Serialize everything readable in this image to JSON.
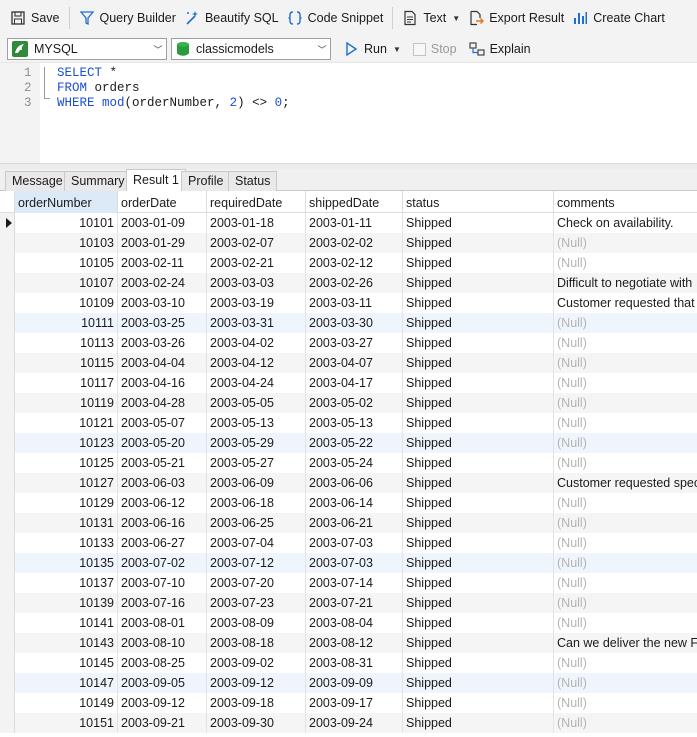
{
  "toolbar": {
    "save": "Save",
    "query_builder": "Query Builder",
    "beautify_sql": "Beautify SQL",
    "code_snippet": "Code Snippet",
    "text": "Text",
    "export_result": "Export Result",
    "create_chart": "Create Chart"
  },
  "connection": {
    "type": "MYSQL",
    "database": "classicmodels"
  },
  "actions": {
    "run": "Run",
    "stop": "Stop",
    "explain": "Explain"
  },
  "editor": {
    "line_numbers": [
      "1",
      "2",
      "3"
    ],
    "line1": {
      "kw": "SELECT",
      "rest": " *"
    },
    "line2": {
      "kw": "FROM",
      "rest": " orders"
    },
    "line3": {
      "kw": "WHERE",
      "fn": "mod",
      "p1": "(orderNumber, ",
      "n1": "2",
      "p2": ") <> ",
      "n2": "0",
      "p3": ";"
    }
  },
  "tabs": [
    "Message",
    "Summary",
    "Result 1",
    "Profile",
    "Status"
  ],
  "active_tab": "Result 1",
  "columns": [
    "orderNumber",
    "orderDate",
    "requiredDate",
    "shippedDate",
    "status",
    "comments"
  ],
  "rows": [
    [
      "10101",
      "2003-01-09",
      "2003-01-18",
      "2003-01-11",
      "Shipped",
      "Check on availability."
    ],
    [
      "10103",
      "2003-01-29",
      "2003-02-07",
      "2003-02-02",
      "Shipped",
      "(Null)"
    ],
    [
      "10105",
      "2003-02-11",
      "2003-02-21",
      "2003-02-12",
      "Shipped",
      "(Null)"
    ],
    [
      "10107",
      "2003-02-24",
      "2003-03-03",
      "2003-02-26",
      "Shipped",
      "Difficult to negotiate with"
    ],
    [
      "10109",
      "2003-03-10",
      "2003-03-19",
      "2003-03-11",
      "Shipped",
      "Customer requested that F"
    ],
    [
      "10111",
      "2003-03-25",
      "2003-03-31",
      "2003-03-30",
      "Shipped",
      "(Null)"
    ],
    [
      "10113",
      "2003-03-26",
      "2003-04-02",
      "2003-03-27",
      "Shipped",
      "(Null)"
    ],
    [
      "10115",
      "2003-04-04",
      "2003-04-12",
      "2003-04-07",
      "Shipped",
      "(Null)"
    ],
    [
      "10117",
      "2003-04-16",
      "2003-04-24",
      "2003-04-17",
      "Shipped",
      "(Null)"
    ],
    [
      "10119",
      "2003-04-28",
      "2003-05-05",
      "2003-05-02",
      "Shipped",
      "(Null)"
    ],
    [
      "10121",
      "2003-05-07",
      "2003-05-13",
      "2003-05-13",
      "Shipped",
      "(Null)"
    ],
    [
      "10123",
      "2003-05-20",
      "2003-05-29",
      "2003-05-22",
      "Shipped",
      "(Null)"
    ],
    [
      "10125",
      "2003-05-21",
      "2003-05-27",
      "2003-05-24",
      "Shipped",
      "(Null)"
    ],
    [
      "10127",
      "2003-06-03",
      "2003-06-09",
      "2003-06-06",
      "Shipped",
      "Customer requested speci"
    ],
    [
      "10129",
      "2003-06-12",
      "2003-06-18",
      "2003-06-14",
      "Shipped",
      "(Null)"
    ],
    [
      "10131",
      "2003-06-16",
      "2003-06-25",
      "2003-06-21",
      "Shipped",
      "(Null)"
    ],
    [
      "10133",
      "2003-06-27",
      "2003-07-04",
      "2003-07-03",
      "Shipped",
      "(Null)"
    ],
    [
      "10135",
      "2003-07-02",
      "2003-07-12",
      "2003-07-03",
      "Shipped",
      "(Null)"
    ],
    [
      "10137",
      "2003-07-10",
      "2003-07-20",
      "2003-07-14",
      "Shipped",
      "(Null)"
    ],
    [
      "10139",
      "2003-07-16",
      "2003-07-23",
      "2003-07-21",
      "Shipped",
      "(Null)"
    ],
    [
      "10141",
      "2003-08-01",
      "2003-08-09",
      "2003-08-04",
      "Shipped",
      "(Null)"
    ],
    [
      "10143",
      "2003-08-10",
      "2003-08-18",
      "2003-08-12",
      "Shipped",
      "Can we deliver the new Fo"
    ],
    [
      "10145",
      "2003-08-25",
      "2003-09-02",
      "2003-08-31",
      "Shipped",
      "(Null)"
    ],
    [
      "10147",
      "2003-09-05",
      "2003-09-12",
      "2003-09-09",
      "Shipped",
      "(Null)"
    ],
    [
      "10149",
      "2003-09-12",
      "2003-09-18",
      "2003-09-17",
      "Shipped",
      "(Null)"
    ],
    [
      "10151",
      "2003-09-21",
      "2003-09-30",
      "2003-09-24",
      "Shipped",
      "(Null)"
    ]
  ],
  "null_text": "(Null)",
  "colors": {
    "keyword": "#1a4fd6",
    "null": "#b4b4b4",
    "accent": "#1f6fd1"
  }
}
